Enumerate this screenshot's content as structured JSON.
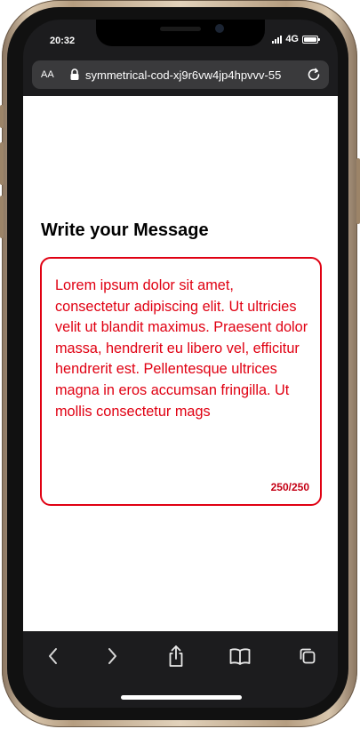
{
  "status_bar": {
    "time": "20:32",
    "network": "4G"
  },
  "address_bar": {
    "text_size_label": "AA",
    "url": "symmetrical-cod-xj9r6vw4jp4hpvvv-55"
  },
  "page": {
    "heading": "Write your Message",
    "message": {
      "text": "Lorem ipsum dolor sit amet, consectetur adipiscing elit. Ut ultricies velit ut blandit maximus. Praesent dolor massa, hendrerit eu libero vel, efficitur hendrerit est. Pellentesque ultrices magna in eros accumsan fringilla. Ut mollis consectetur mags",
      "counter": "250/250"
    }
  },
  "toolbar": {
    "items": [
      "back-icon",
      "forward-icon",
      "share-icon",
      "bookmarks-icon",
      "tabs-icon"
    ]
  },
  "colors": {
    "accent": "#e00012",
    "counter": "#c40014",
    "browser_chrome": "#1c1c1e",
    "url_pill": "#3a3a3c"
  }
}
